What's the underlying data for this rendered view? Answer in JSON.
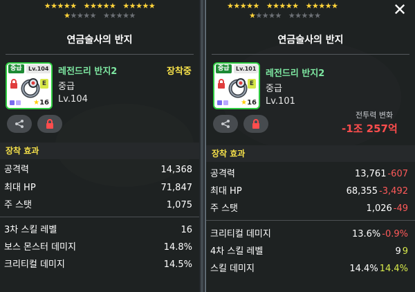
{
  "left": {
    "stars_top": [
      "★★★★★",
      "★★★★★",
      "★★★★★"
    ],
    "stars_second": {
      "on": "★",
      "off_a": "★★★★",
      "off_b": "★★★★★"
    },
    "title": "연금술사의 반지",
    "icon": {
      "grade": "중급",
      "lv_tag": "Lv.104",
      "star_level": "16",
      "e_badge": "E"
    },
    "name": "레전드리 반지2",
    "grade": "중급",
    "level": "Lv.104",
    "equipped": "장착중",
    "section_title": "장착 효과",
    "stats": [
      {
        "label": "공격력",
        "value": "14,368"
      },
      {
        "label": "최대 HP",
        "value": "71,847"
      },
      {
        "label": "주 스탯",
        "value": "1,075"
      }
    ],
    "stats2": [
      {
        "label": "3차 스킬 레벨",
        "value": "16"
      },
      {
        "label": "보스 몬스터 데미지",
        "value": "14.8%"
      },
      {
        "label": "크리티컬 데미지",
        "value": "14.5%"
      }
    ]
  },
  "right": {
    "stars_top": [
      "★★★★★",
      "★★★★★",
      "★★★★★"
    ],
    "stars_second": {
      "on": "★",
      "off_a": "★★★★",
      "off_b": "★★★★★"
    },
    "title": "연금술사의 반지",
    "icon": {
      "grade": "중급",
      "lv_tag": "Lv.101",
      "star_level": "16",
      "e_badge": "E"
    },
    "name": "레전드리 반지2",
    "grade": "중급",
    "level": "Lv.101",
    "power_label": "전투력 변화",
    "power_value": "-1조 257억",
    "section_title": "장착 효과",
    "close_glyph": "✕",
    "stats": [
      {
        "label": "공격력",
        "value": "13,761",
        "diff": "-607"
      },
      {
        "label": "최대 HP",
        "value": "68,355",
        "diff": "-3,492"
      },
      {
        "label": "주 스탯",
        "value": "1,026",
        "diff": "-49"
      }
    ],
    "stats2": [
      {
        "label": "크리티컬 데미지",
        "value": "13.6%",
        "diff": "-0.9%"
      },
      {
        "label": "4차 스킬 레벨",
        "value": "9",
        "diff": "9"
      },
      {
        "label": "스킬 데미지",
        "value": "14.4%",
        "diff": "14.4%"
      }
    ]
  },
  "colors": {
    "star_on": "#ffd43a",
    "star_off": "#6c7075",
    "item_name": "#7ee8a2",
    "equipped": "#f6e14a",
    "negative": "#ff5a5a",
    "positive": "#d8ea4b",
    "grade_border": "#2ecc40"
  },
  "icons": [
    "share-icon",
    "lock-icon",
    "close-icon",
    "ring-icon"
  ]
}
